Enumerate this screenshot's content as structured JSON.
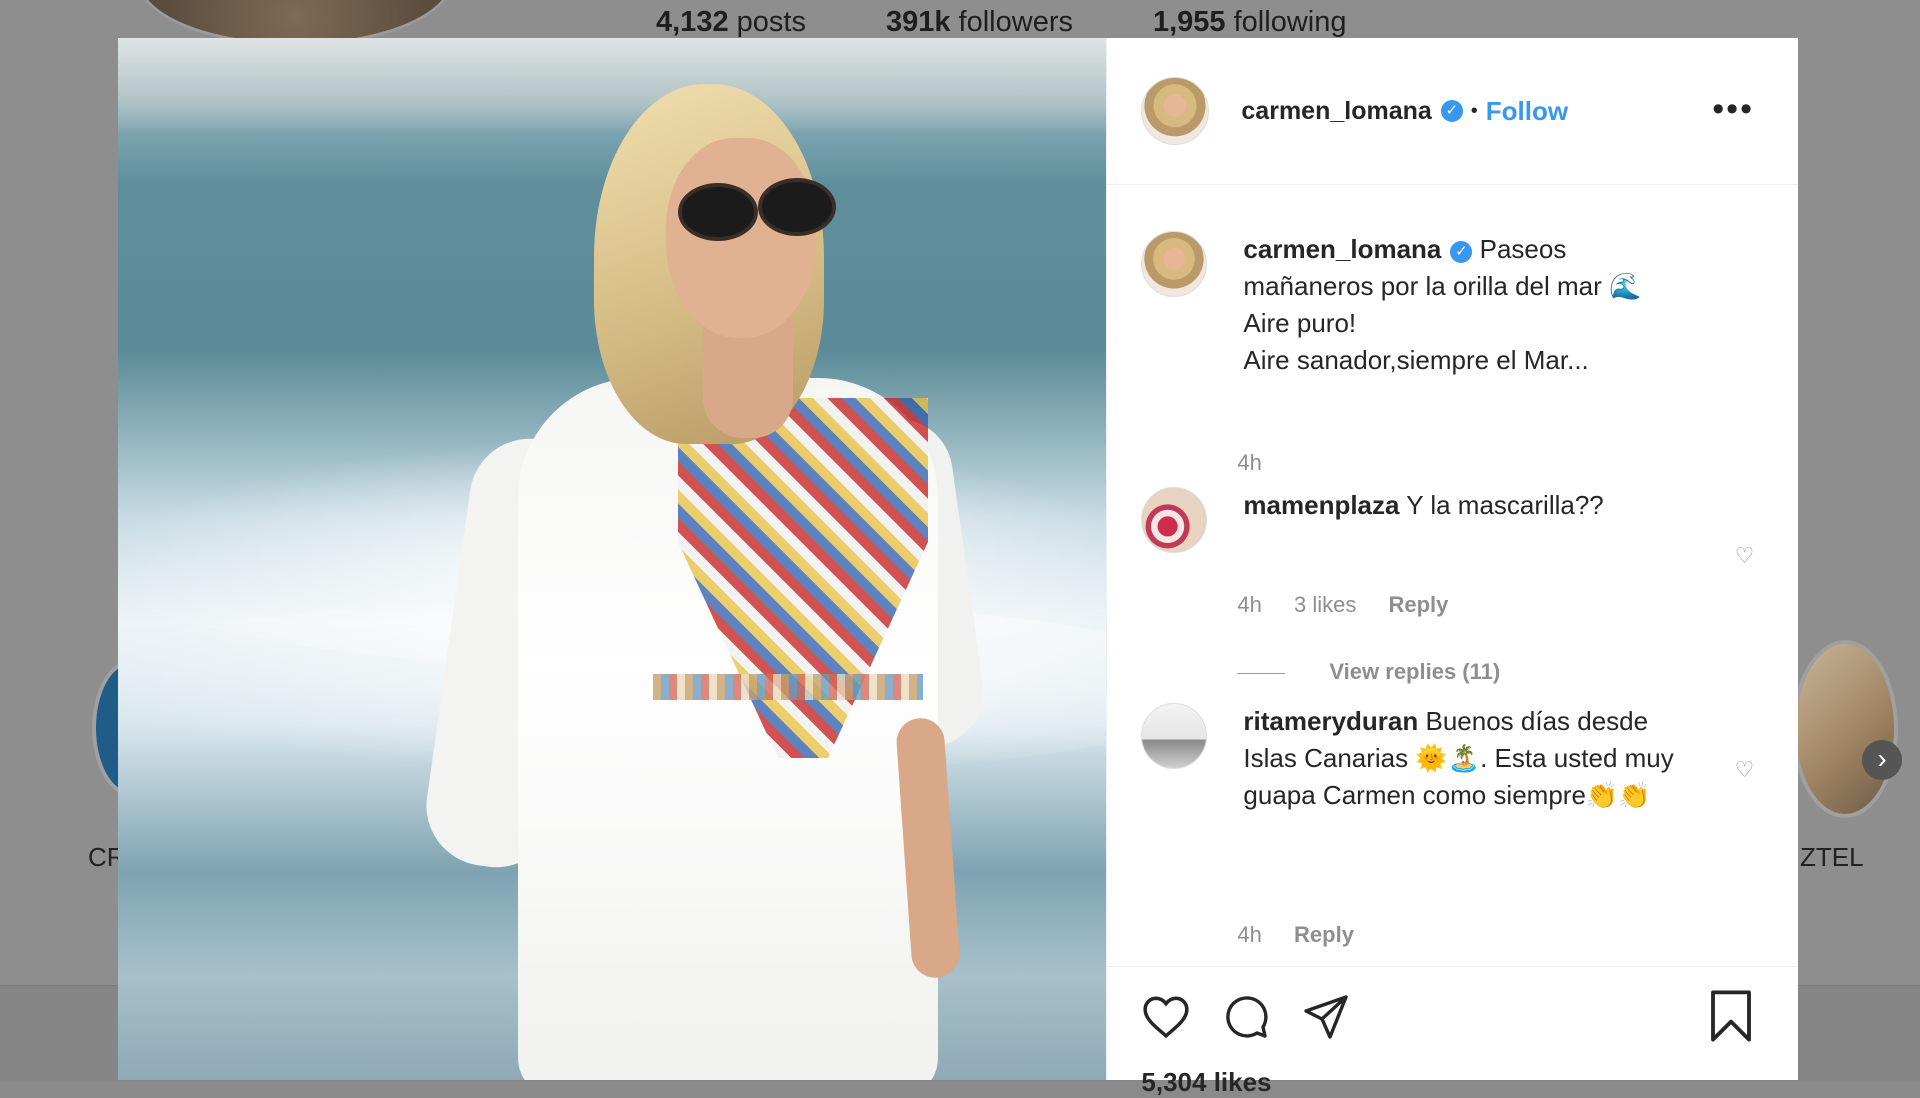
{
  "background": {
    "stats": [
      {
        "num": "4,132",
        "label": "posts"
      },
      {
        "num": "391k",
        "label": "followers"
      },
      {
        "num": "1,955",
        "label": "following"
      }
    ],
    "highlight_left_label": "CR",
    "highlight_right_label": "ZTEL",
    "next_arrow": "›"
  },
  "post": {
    "header": {
      "username": "carmen_lomana",
      "verified_glyph": "✓",
      "separator": "•",
      "follow_label": "Follow",
      "more_glyph": "•••"
    },
    "caption": {
      "username": "carmen_lomana",
      "text_line1": "Paseos mañaneros por la orilla del mar 🌊",
      "text_line2": "Aire puro!",
      "text_line3": "Aire sanador,siempre el Mar...",
      "time": "4h"
    },
    "comments": [
      {
        "username": "mamenplaza",
        "text": "Y la mascarilla??",
        "time": "4h",
        "likes": "3 likes",
        "reply_label": "Reply",
        "view_replies": "View replies (11)"
      },
      {
        "username": "ritameryduran",
        "text": "Buenos días desde Islas Canarias 🌞🏝️. Esta usted muy guapa Carmen como siempre👏👏",
        "time": "4h",
        "reply_label": "Reply"
      }
    ],
    "likes_count": "5,304 likes"
  },
  "icons": {
    "heart": "heart-icon",
    "comment": "comment-icon",
    "share": "share-icon",
    "bookmark": "bookmark-icon",
    "small_heart": "small-heart-icon"
  },
  "colors": {
    "link_blue": "#3897f0",
    "text": "#262626",
    "muted": "#8e8e8e"
  }
}
